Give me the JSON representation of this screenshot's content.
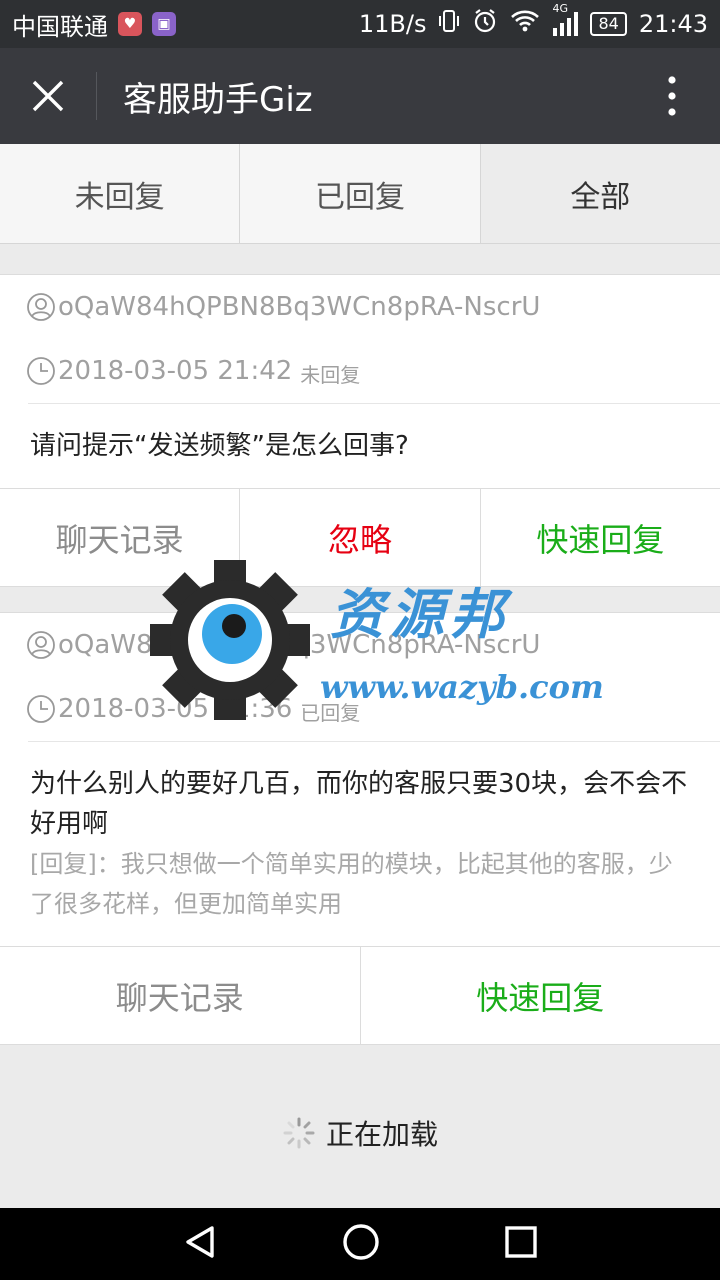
{
  "status_bar": {
    "carrier": "中国联通",
    "speed": "11B/s",
    "network": "4G",
    "battery": "84",
    "time": "21:43"
  },
  "titlebar": {
    "title": "客服助手Giz"
  },
  "tabs": [
    {
      "label": "未回复"
    },
    {
      "label": "已回复"
    },
    {
      "label": "全部",
      "active": true
    }
  ],
  "messages": [
    {
      "user": "oQaW84hQPBN8Bq3WCn8pRA-NscrU",
      "time": "2018-03-05 21:42",
      "status": "未回复",
      "content": "请问提示“发送频繁”是怎么回事?",
      "actions": [
        "聊天记录",
        "忽略",
        "快速回复"
      ]
    },
    {
      "user": "oQaW84hQPBN8Bq3WCn8pRA-NscrU",
      "time": "2018-03-05 21:36",
      "status": "已回复",
      "content": "为什么别人的要好几百，而你的客服只要30块，会不会不好用啊",
      "reply": "[回复]：我只想做一个简单实用的模块，比起其他的客服，少了很多花样，但更加简单实用",
      "actions": [
        "聊天记录",
        "快速回复"
      ]
    }
  ],
  "loading": {
    "text": "正在加载"
  },
  "watermark": {
    "text": "资源邦",
    "url": "www.wazyb.com"
  },
  "colors": {
    "titlebar": "#393a3f",
    "ignore": "#e60012",
    "quick_reply": "#1aad19"
  }
}
